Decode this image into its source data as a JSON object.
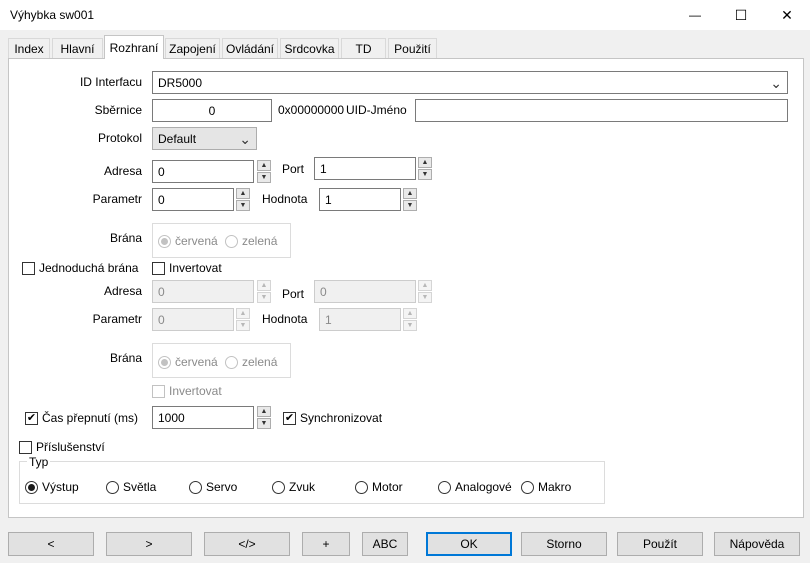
{
  "window": {
    "title": "Výhybka sw001",
    "minimize_glyph": "—",
    "maximize_glyph": "☐",
    "close_glyph": "✕"
  },
  "tabs": [
    "Index",
    "Hlavní",
    "Rozhraní",
    "Zapojení",
    "Ovládání",
    "Srdcovka",
    "TD",
    "Použití"
  ],
  "form": {
    "interface_label": "ID Interfacu",
    "interface_value": "DR5000",
    "bus_label": "Sběrnice",
    "bus_value": "0",
    "bus_hex": "0x00000000",
    "uid_label": "UID-Jméno",
    "uid_value": "",
    "protocol_label": "Protokol",
    "protocol_value": "Default",
    "address_label": "Adresa",
    "address_value": "0",
    "port_label": "Port",
    "port_value": "1",
    "param_label": "Parametr",
    "param_value": "0",
    "value_label": "Hodnota",
    "value_value": "1",
    "gate_label": "Brána",
    "gate_red": "červená",
    "gate_green": "zelená",
    "simple_gate_label": "Jednoduchá brána",
    "invert_label": "Invertovat",
    "address2_label": "Adresa",
    "address2_value": "0",
    "port2_label": "Port",
    "port2_value": "0",
    "param2_label": "Parametr",
    "param2_value": "0",
    "value2_label": "Hodnota",
    "value2_value": "1",
    "gate2_label": "Brána",
    "gate2_red": "červená",
    "gate2_green": "zelená",
    "invert2_label": "Invertovat",
    "switch_time_label": "Čas přepnutí (ms)",
    "switch_time_value": "1000",
    "sync_label": "Synchronizovat",
    "accessory_label": "Příslušenství",
    "type_label": "Typ",
    "type_options": [
      "Výstup",
      "Světla",
      "Servo",
      "Zvuk",
      "Motor",
      "Analogové",
      "Makro"
    ]
  },
  "buttons": {
    "prev": "<",
    "next": ">",
    "code": "</>",
    "plus": "+",
    "abc": "ABC",
    "ok": "OK",
    "cancel": "Storno",
    "apply": "Použít",
    "help": "Nápověda"
  },
  "glyphs": {
    "up": "▲",
    "down": "▼",
    "chevron": "⌄",
    "check": "✔"
  }
}
